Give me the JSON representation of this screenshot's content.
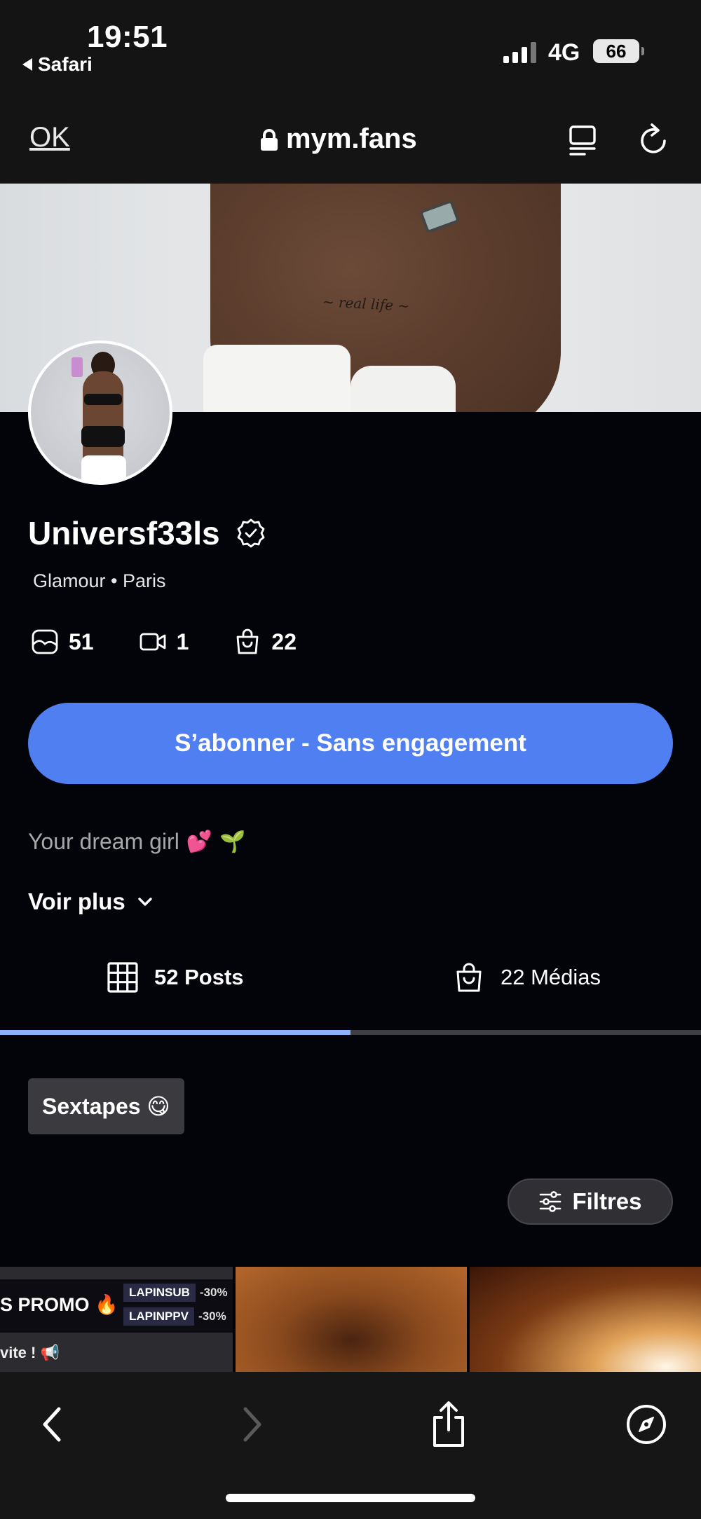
{
  "status_bar": {
    "time": "19:51",
    "back_app": "Safari",
    "network": "4G",
    "battery": "66"
  },
  "url_bar": {
    "done_label": "OK",
    "domain": "mym.fans",
    "icons": [
      "lock-icon",
      "reader-mode-icon",
      "reload-icon"
    ]
  },
  "profile": {
    "username": "Universf33ls",
    "subtitle": "Glamour • Paris",
    "stats": {
      "photos": "51",
      "videos": "1",
      "purchases": "22"
    },
    "subscribe_label": "S’abonner - Sans engagement",
    "bio": "Your dream girl",
    "bio_emojis": [
      "💕",
      "🌱"
    ],
    "see_more_label": "Voir plus"
  },
  "tabs": [
    {
      "label": "52 Posts",
      "icon": "grid-icon",
      "active": true
    },
    {
      "label": "22 Médias",
      "icon": "bag-icon",
      "active": false
    }
  ],
  "chip": {
    "label": "Sextapes 😋"
  },
  "filters": {
    "label": "Filtres"
  },
  "grid": {
    "promo": {
      "title": "S PROMO 🔥",
      "codes": [
        {
          "name": "LAPINSUB",
          "discount": "-30%"
        },
        {
          "name": "LAPINPPV",
          "discount": "-30%"
        }
      ],
      "note": "vite ! 📢"
    }
  },
  "toolbar": {
    "icons": [
      "back-icon",
      "forward-icon",
      "share-icon",
      "compass-icon"
    ]
  },
  "colors": {
    "accent": "#4f7ff0",
    "background": "#03030a",
    "tab_active": "#8fb1f8"
  }
}
